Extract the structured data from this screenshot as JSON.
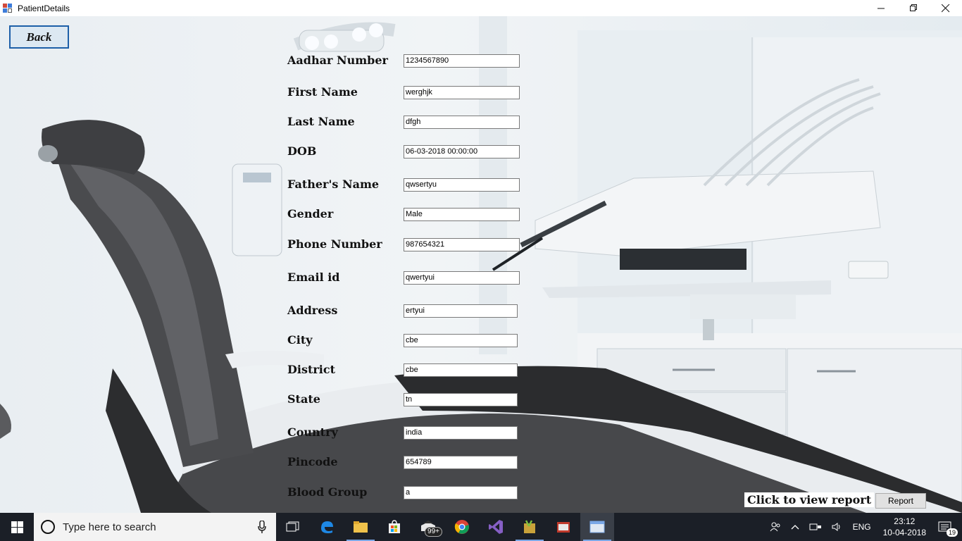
{
  "window": {
    "title": "PatientDetails",
    "controls": {
      "minimize": "—",
      "restore": "❐",
      "close": "✕"
    }
  },
  "back_button": "Back",
  "form": {
    "fields": [
      {
        "label": "Aadhar Number",
        "value": "1234567890"
      },
      {
        "label": "First Name",
        "value": "werghjk"
      },
      {
        "label": "Last Name",
        "value": "dfgh"
      },
      {
        "label": "DOB",
        "value": "06-03-2018 00:00:00"
      },
      {
        "label": "Father's Name",
        "value": "qwsertyu"
      },
      {
        "label": "Gender",
        "value": "Male"
      },
      {
        "label": "Phone Number",
        "value": "987654321"
      },
      {
        "label": "Email id",
        "value": "qwertyui"
      },
      {
        "label": "Address",
        "value": "ertyui"
      },
      {
        "label": "City",
        "value": "cbe"
      },
      {
        "label": "District",
        "value": "cbe"
      },
      {
        "label": "State",
        "value": "tn"
      },
      {
        "label": "Country",
        "value": "india"
      },
      {
        "label": "Pincode",
        "value": "654789"
      },
      {
        "label": "Blood Group",
        "value": "a"
      }
    ]
  },
  "report": {
    "label": "Click to view report",
    "button": "Report"
  },
  "taskbar": {
    "search_placeholder": "Type here to search",
    "apps": [
      "task-view-icon",
      "edge-icon",
      "file-explorer-icon",
      "store-icon",
      "mail-icon",
      "chrome-icon",
      "visual-studio-icon",
      "tools-icon",
      "app-red-icon",
      "window-app-icon"
    ],
    "mail_badge": "99+",
    "tray": {
      "language": "ENG",
      "time": "23:12",
      "date": "10-04-2018",
      "notifications": "19"
    }
  }
}
